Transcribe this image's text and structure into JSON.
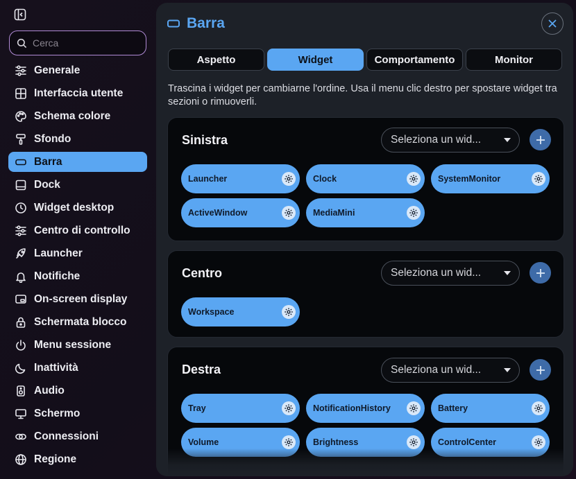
{
  "sidebar": {
    "search_placeholder": "Cerca",
    "items": [
      {
        "label": "Generale",
        "icon": "sliders-icon"
      },
      {
        "label": "Interfaccia utente",
        "icon": "layout-icon"
      },
      {
        "label": "Schema colore",
        "icon": "palette-icon"
      },
      {
        "label": "Sfondo",
        "icon": "brush-icon"
      },
      {
        "label": "Barra",
        "icon": "bar-icon",
        "active": true
      },
      {
        "label": "Dock",
        "icon": "dock-icon"
      },
      {
        "label": "Widget desktop",
        "icon": "clock-icon"
      },
      {
        "label": "Centro di controllo",
        "icon": "sliders-icon"
      },
      {
        "label": "Launcher",
        "icon": "rocket-icon"
      },
      {
        "label": "Notifiche",
        "icon": "bell-icon"
      },
      {
        "label": "On-screen display",
        "icon": "osd-icon"
      },
      {
        "label": "Schermata blocco",
        "icon": "lock-icon"
      },
      {
        "label": "Menu sessione",
        "icon": "power-icon"
      },
      {
        "label": "Inattività",
        "icon": "moon-icon"
      },
      {
        "label": "Audio",
        "icon": "speaker-icon"
      },
      {
        "label": "Schermo",
        "icon": "monitor-icon"
      },
      {
        "label": "Connessioni",
        "icon": "link-icon"
      },
      {
        "label": "Regione",
        "icon": "globe-icon"
      }
    ]
  },
  "panel": {
    "title": "Barra",
    "tabs": [
      {
        "label": "Aspetto"
      },
      {
        "label": "Widget",
        "active": true
      },
      {
        "label": "Comportamento"
      },
      {
        "label": "Monitor"
      }
    ],
    "description": "Trascina i widget per cambiarne l'ordine. Usa il menu clic destro per spostare widget tra sezioni o rimuoverli.",
    "sections": [
      {
        "title": "Sinistra",
        "select_placeholder": "Seleziona un wid...",
        "widgets": [
          "Launcher",
          "Clock",
          "SystemMonitor",
          "ActiveWindow",
          "MediaMini"
        ]
      },
      {
        "title": "Centro",
        "select_placeholder": "Seleziona un wid...",
        "widgets": [
          "Workspace"
        ]
      },
      {
        "title": "Destra",
        "select_placeholder": "Seleziona un wid...",
        "widgets": [
          "Tray",
          "NotificationHistory",
          "Battery",
          "Volume",
          "Brightness",
          "ControlCenter"
        ]
      }
    ]
  },
  "colors": {
    "accent": "#5aa6f2",
    "add_button": "#3e6ba8",
    "search_border": "#b18bd6"
  }
}
